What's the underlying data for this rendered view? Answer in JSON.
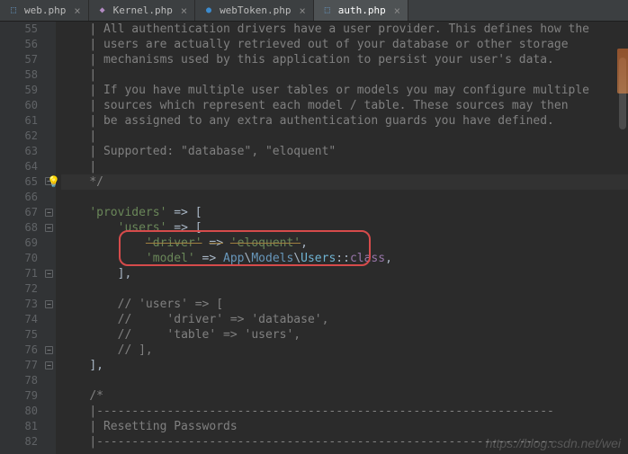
{
  "tabs": [
    {
      "label": "web.php",
      "icon_color": "#6fa8dc"
    },
    {
      "label": "Kernel.php",
      "icon_color": "#b28ac2"
    },
    {
      "label": "webToken.php",
      "icon_color": "#3c8ccf"
    },
    {
      "label": "auth.php",
      "icon_color": "#6fa8dc",
      "active": true
    }
  ],
  "gutter": {
    "start": 55,
    "end": 82
  },
  "code": {
    "l55": "| All authentication drivers have a user provider. This defines how the",
    "l55b": "| users are actually retrieved out of your database or other storage",
    "l56": "| mechanisms used by this application to persist your user's data.",
    "l57": "|",
    "l58": "| If you have multiple user tables or models you may configure multiple",
    "l59": "| sources which represent each model / table. These sources may then",
    "l60": "| be assigned to any extra authentication guards you have defined.",
    "l61": "|",
    "l62": "| Supported: \"database\", \"eloquent\"",
    "l63": "|",
    "l64": "*/",
    "providers": "'providers'",
    "users": "'users'",
    "driver": "'driver'",
    "eloquent": "'eloquent'",
    "model": "'model'",
    "ns1": "App",
    "ns2": "Models",
    "cls": "Users",
    "classkw": "class",
    "c_users": "// 'users' => [",
    "c_driver": "//     'driver' => 'database',",
    "c_table": "//     'table' => 'users',",
    "c_close": "// ],",
    "c_blockopen": "/*",
    "c_hr": "|-----------------------------------------------------------------",
    "c_reset": "| Resetting Passwords",
    "c_hr2": "|-----------------------------------------------------------------"
  },
  "watermark": "https://blog.csdn.net/wei"
}
